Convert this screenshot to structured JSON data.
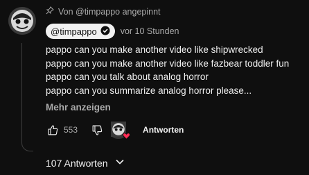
{
  "pinned": {
    "text": "Von @timpappo angepinnt",
    "icon": "pin-icon"
  },
  "author": {
    "handle": "@timpappo",
    "verified_icon": "verified-checkmark-icon",
    "time": "vor 10 Stunden"
  },
  "comment": {
    "lines": [
      "pappo can you make another video like shipwrecked",
      "pappo can you make another video like fazbear toddler fun",
      "pappo can you talk about analog horror",
      "pappo can you summarize analog horror please..."
    ],
    "more_label": "Mehr anzeigen"
  },
  "actions": {
    "likes": "553",
    "reply_label": "Antworten"
  },
  "replies": {
    "label": "107 Antworten"
  },
  "colors": {
    "background": "#0f0f0f",
    "text": "#f1f1f1",
    "muted": "#aaaaaa",
    "heart": "#ff2d55"
  }
}
